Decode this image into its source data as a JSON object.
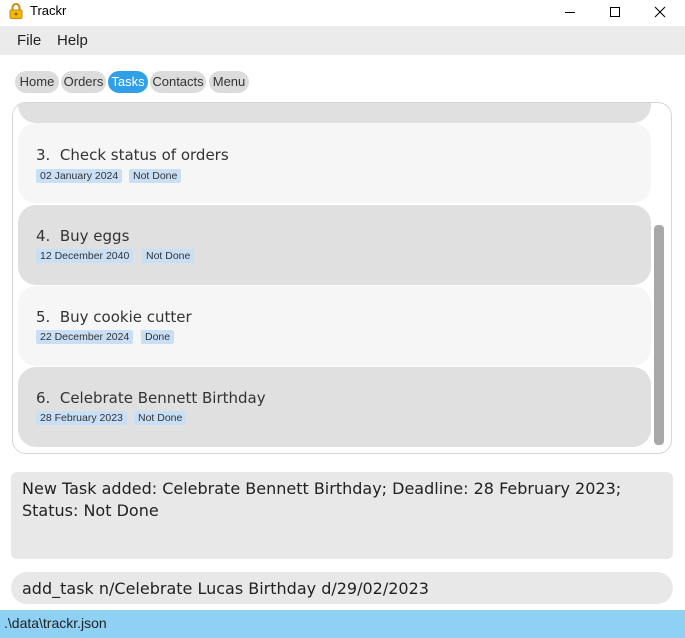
{
  "window": {
    "title": "Trackr"
  },
  "menu": {
    "file": "File",
    "help": "Help"
  },
  "tabs": [
    {
      "label": "Home",
      "active": false
    },
    {
      "label": "Orders",
      "active": false
    },
    {
      "label": "Tasks",
      "active": true
    },
    {
      "label": "Contacts",
      "active": false
    },
    {
      "label": "Menu",
      "active": false
    }
  ],
  "tasks": [
    {
      "index": "3.",
      "name": "Check status of orders",
      "deadline": "02 January 2024",
      "status": "Not Done"
    },
    {
      "index": "4.",
      "name": "Buy eggs",
      "deadline": "12 December 2040",
      "status": "Not Done"
    },
    {
      "index": "5.",
      "name": "Buy cookie cutter",
      "deadline": "22 December 2024",
      "status": "Done"
    },
    {
      "index": "6.",
      "name": "Celebrate Bennett Birthday",
      "deadline": "28 February 2023",
      "status": "Not Done"
    }
  ],
  "result": {
    "text": "New Task added: Celebrate Bennett Birthday; Deadline: 28 February 2023; Status: Not Done"
  },
  "command": {
    "value": "add_task n/Celebrate Lucas Birthday d/29/02/2023"
  },
  "status": {
    "path": ".\\data\\trackr.json"
  },
  "colors": {
    "accent": "#2f9fe8",
    "statusbar": "#8fd0f5",
    "chip": "#c9dff5"
  }
}
